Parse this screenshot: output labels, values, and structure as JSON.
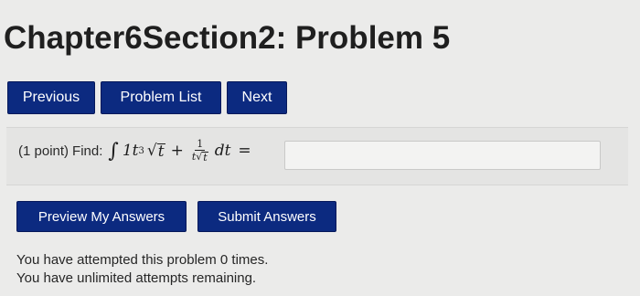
{
  "page": {
    "title": "Chapter6Section2: Problem 5"
  },
  "nav": {
    "previous_label": "Previous",
    "problem_list_label": "Problem List",
    "next_label": "Next"
  },
  "problem": {
    "points": "(1 point)",
    "find": "Find:",
    "math": {
      "integral_sign": "∫",
      "coefficient": "1t",
      "exponent": "3",
      "sqrt_sign": "√",
      "sqrt_var": "t",
      "plus": "+",
      "frac_numerator": "1",
      "frac_denominator_var": "t",
      "frac_denominator_sqrt_var": "t",
      "dt": "dt",
      "equals": "="
    },
    "answer_value": ""
  },
  "actions": {
    "preview_label": "Preview My Answers",
    "submit_label": "Submit Answers"
  },
  "status": {
    "attempted": "You have attempted this problem 0 times.",
    "remaining": "You have unlimited attempts remaining."
  },
  "colors": {
    "button_bg": "#0c2a80",
    "page_bg": "#ebebea"
  }
}
